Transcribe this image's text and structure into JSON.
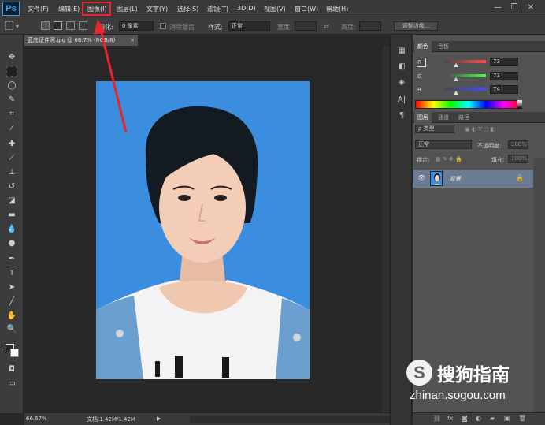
{
  "app": {
    "logo": "Ps"
  },
  "menu": {
    "items": [
      {
        "label": "文件(F)"
      },
      {
        "label": "编辑(E)"
      },
      {
        "label": "图像(I)"
      },
      {
        "label": "图层(L)"
      },
      {
        "label": "文字(Y)"
      },
      {
        "label": "选择(S)"
      },
      {
        "label": "滤镜(T)"
      },
      {
        "label": "3D(D)"
      },
      {
        "label": "视图(V)"
      },
      {
        "label": "窗口(W)"
      },
      {
        "label": "帮助(H)"
      }
    ],
    "highlighted": "图像(I)",
    "window_buttons": {
      "minimize": "—",
      "restore": "❐",
      "close": "✕"
    }
  },
  "options_bar": {
    "feather_label": "羽化:",
    "feather_value": "0 像素",
    "antialias_label": "消除锯齿",
    "style_label": "样式:",
    "style_value": "正常",
    "width_label": "宽度:",
    "height_label": "高度:",
    "adjust_edge_button": "调整边缘..."
  },
  "document": {
    "tab_title": "蓝底证件照.jpg @ 66.7% (RGB/8)",
    "tab_close": "×",
    "background_color": "#3a8ddf"
  },
  "status_bar": {
    "zoom": "66.67%",
    "doc_info": "文档:1.42M/1.42M",
    "arrow": "▶"
  },
  "color_panel": {
    "tabs": [
      "颜色",
      "色板"
    ],
    "channels": [
      {
        "label": "R",
        "value": "73"
      },
      {
        "label": "G",
        "value": "73"
      },
      {
        "label": "B",
        "value": "74"
      }
    ]
  },
  "layers_panel": {
    "tabs": [
      "图层",
      "通道",
      "路径"
    ],
    "filter_label": "ρ 类型",
    "blend_mode": "正常",
    "opacity_label": "不透明度:",
    "opacity_value": "100%",
    "lock_label": "锁定:",
    "fill_label": "填充:",
    "fill_value": "100%",
    "layers": [
      {
        "name": "背景",
        "visible": true,
        "locked": true
      }
    ]
  },
  "watermark": {
    "logo_letter": "S",
    "text": "搜狗指南",
    "url": "zhinan.sogou.com"
  },
  "colors": {
    "accent_red": "#e8262b",
    "photo_blue": "#3a8ddf",
    "layer_selected": "#6b7b91"
  }
}
